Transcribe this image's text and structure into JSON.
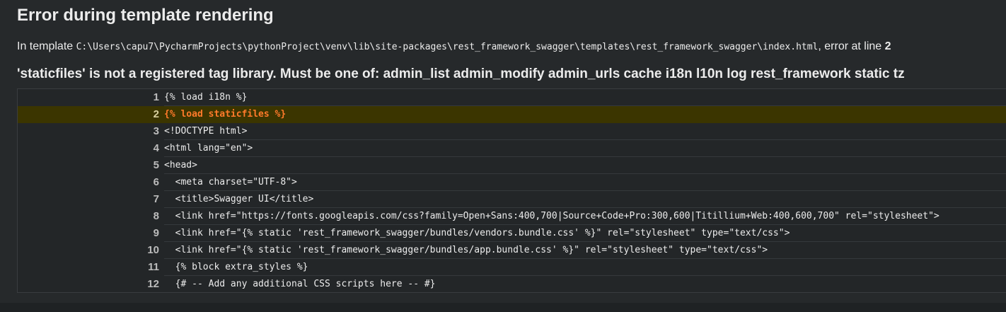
{
  "page": {
    "title": "Error during template rendering",
    "template_prefix": "In template ",
    "template_path": "C:\\Users\\capu7\\PycharmProjects\\pythonProject\\venv\\lib\\site-packages\\rest_framework_swagger\\templates\\rest_framework_swagger\\index.html",
    "template_mid": ", error at line ",
    "error_line": "2",
    "error_message": "'staticfiles' is not a registered tag library. Must be one of: admin_list admin_modify admin_urls cache i18n l10n log rest_framework static tz"
  },
  "source": {
    "lines": [
      {
        "num": "1",
        "code": "{% load i18n %}",
        "error": false
      },
      {
        "num": "2",
        "code": "{% load staticfiles %}",
        "error": true
      },
      {
        "num": "3",
        "code": "<!DOCTYPE html>",
        "error": false
      },
      {
        "num": "4",
        "code": "<html lang=\"en\">",
        "error": false
      },
      {
        "num": "5",
        "code": "<head>",
        "error": false
      },
      {
        "num": "6",
        "code": "  <meta charset=\"UTF-8\">",
        "error": false
      },
      {
        "num": "7",
        "code": "  <title>Swagger UI</title>",
        "error": false
      },
      {
        "num": "8",
        "code": "  <link href=\"https://fonts.googleapis.com/css?family=Open+Sans:400,700|Source+Code+Pro:300,600|Titillium+Web:400,600,700\" rel=\"stylesheet\">",
        "error": false
      },
      {
        "num": "9",
        "code": "  <link href=\"{% static 'rest_framework_swagger/bundles/vendors.bundle.css' %}\" rel=\"stylesheet\" type=\"text/css\">",
        "error": false
      },
      {
        "num": "10",
        "code": "  <link href=\"{% static 'rest_framework_swagger/bundles/app.bundle.css' %}\" rel=\"stylesheet\" type=\"text/css\">",
        "error": false
      },
      {
        "num": "11",
        "code": "  {% block extra_styles %}",
        "error": false
      },
      {
        "num": "12",
        "code": "  {# -- Add any additional CSS scripts here -- #}",
        "error": false
      }
    ]
  }
}
